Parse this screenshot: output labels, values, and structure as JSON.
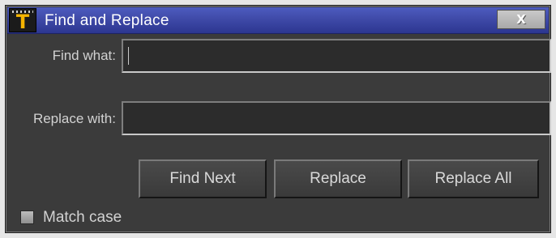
{
  "window": {
    "title": "Find and Replace",
    "app_icon_glyph": "T",
    "close_glyph": "X"
  },
  "find": {
    "label": "Find what:",
    "value": ""
  },
  "replace": {
    "label": "Replace with:",
    "value": ""
  },
  "buttons": {
    "find_next": "Find Next",
    "replace": "Replace",
    "replace_all": "Replace All"
  },
  "options": {
    "match_case_label": "Match case",
    "match_case_checked": false
  },
  "colors": {
    "titlebar": "#3f4aa8",
    "dialog_background": "#3b3b3b",
    "icon_accent": "#f5b400"
  },
  "icons": {
    "app": "app-t-icon",
    "close": "close-icon"
  }
}
